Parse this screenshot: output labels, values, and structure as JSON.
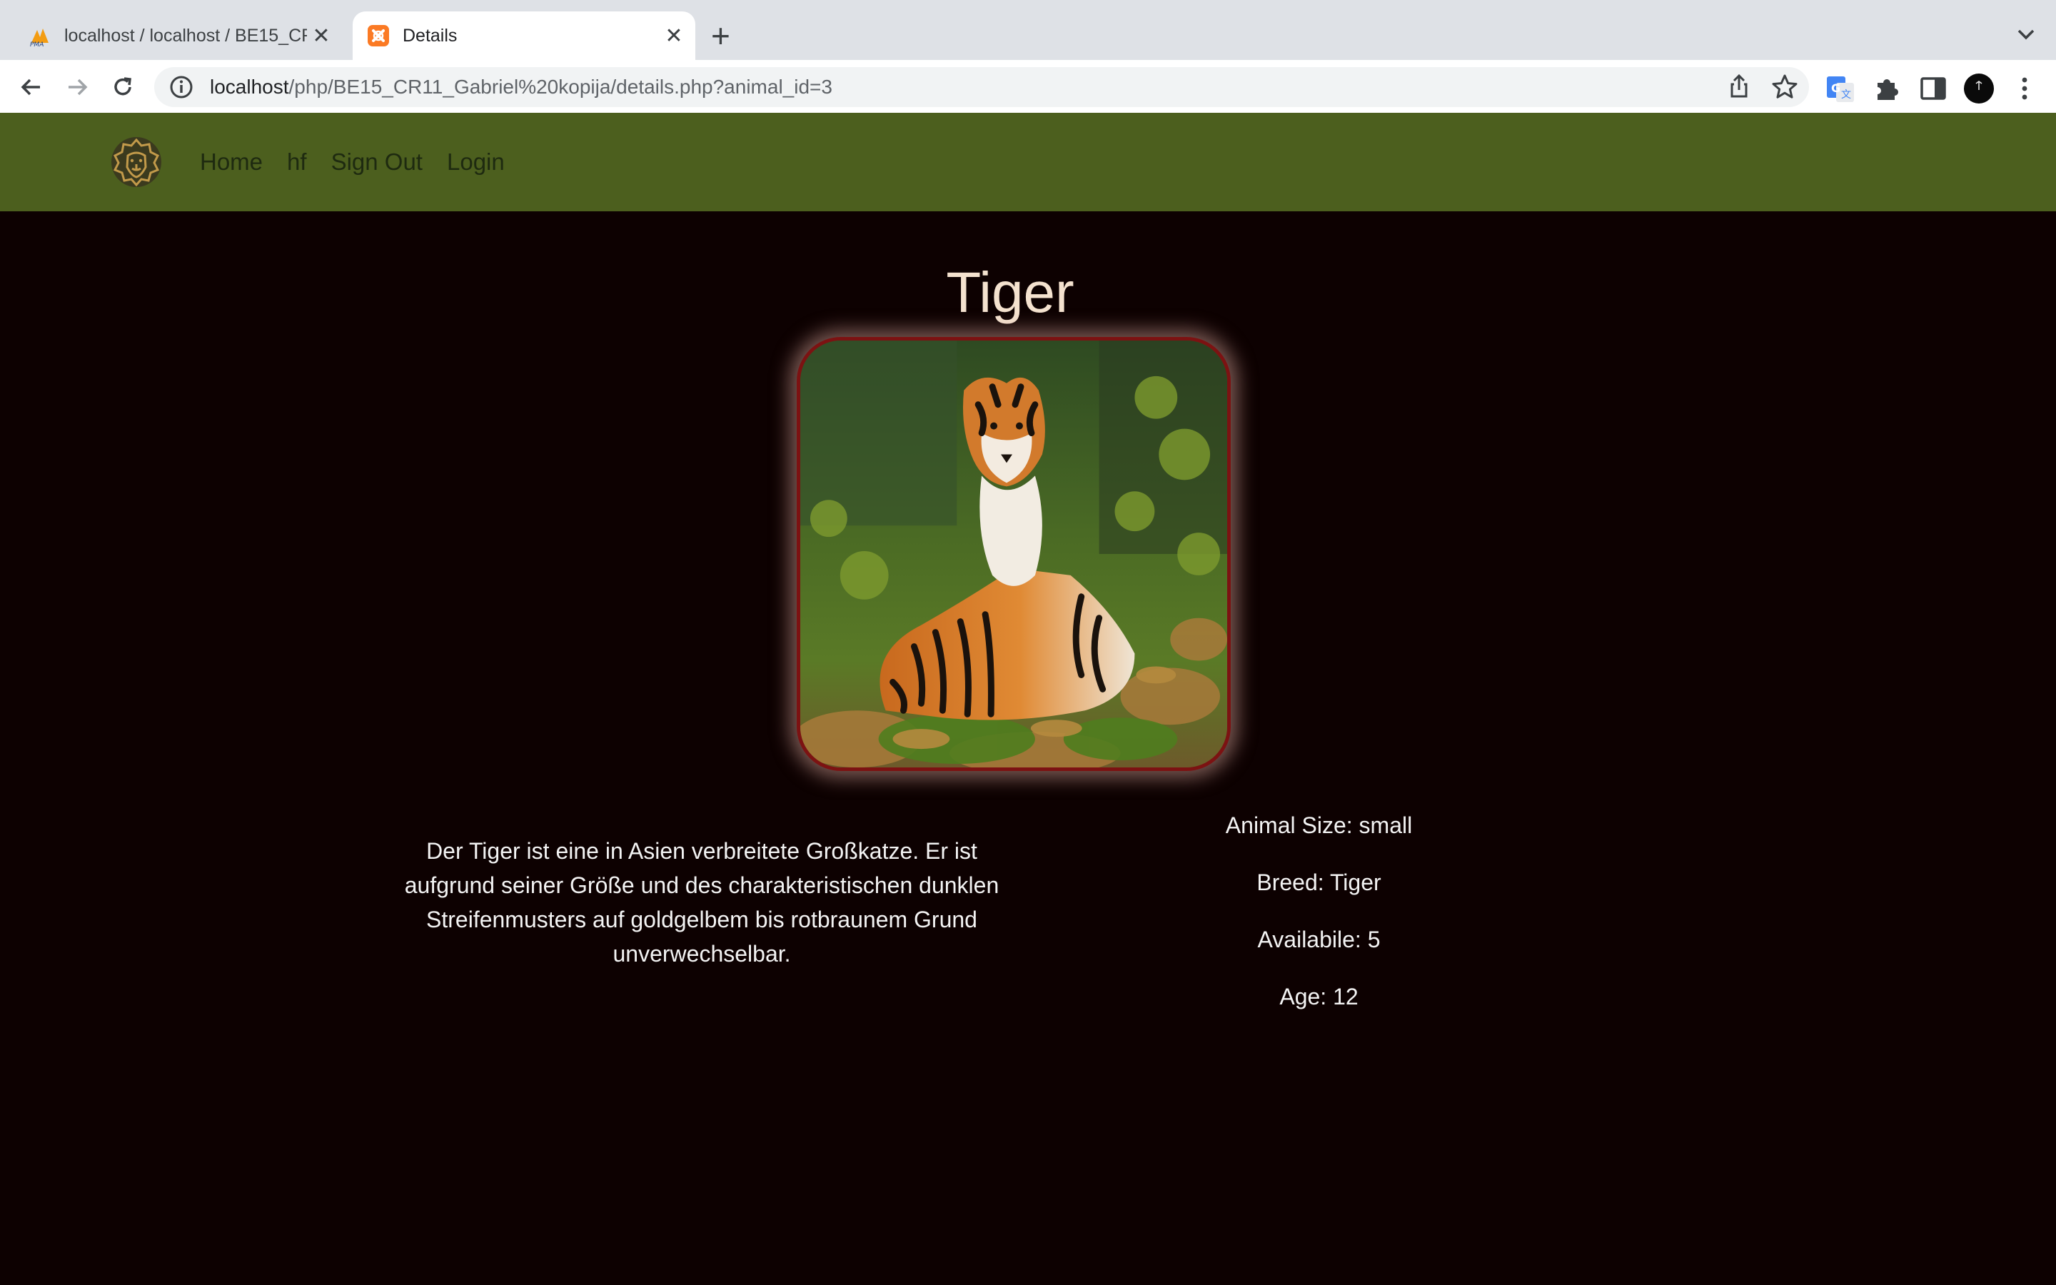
{
  "browser": {
    "tabs": [
      {
        "title": "localhost / localhost / BE15_CR",
        "icon": "phpmyadmin-icon",
        "active": false
      },
      {
        "title": "Details",
        "icon": "xampp-icon",
        "active": true
      }
    ],
    "url_host": "localhost",
    "url_path": "/php/BE15_CR11_Gabriel%20kopija/details.php?animal_id=3"
  },
  "site": {
    "logo": "lion-logo-icon",
    "nav": [
      "Home",
      "hf",
      "Sign Out",
      "Login"
    ]
  },
  "animal": {
    "name": "Tiger",
    "image": "tiger-photo",
    "description": "Der Tiger ist eine in Asien verbreitete Großkatze. Er ist aufgrund seiner Größe und des charakteristischen dunklen Streifenmusters auf goldgelbem bis rotbraunem Grund unverwechselbar.",
    "size": "Animal Size: small",
    "breed": "Breed: Tiger",
    "available": "Availabile: 5",
    "age": "Age: 12"
  },
  "colors": {
    "nav_bg": "#4c5f1e",
    "page_bg": "#0d0101",
    "title": "#f4e2cf",
    "frame_border": "#7c1212"
  }
}
